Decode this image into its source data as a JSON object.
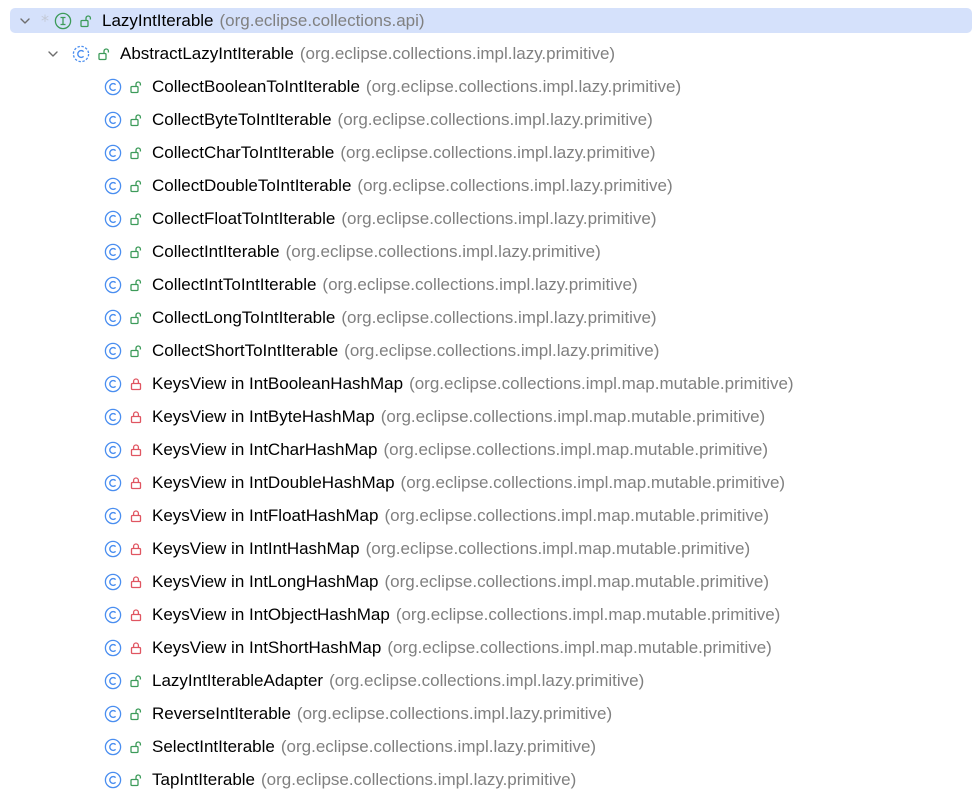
{
  "colors": {
    "selection": "#d5e1fb",
    "interface_icon": "#3d9b5a",
    "class_icon": "#4a8ef0",
    "public_lock": "#3d9b5a",
    "private_lock": "#e05561",
    "package_text": "#808080"
  },
  "tree": {
    "root": {
      "name": "LazyIntIterable",
      "package": "(org.eclipse.collections.api)",
      "kind_icon": "interface-icon",
      "visibility_icon": "public-lock-icon",
      "expanded": true,
      "selected": true
    },
    "parent": {
      "name": "AbstractLazyIntIterable",
      "package": "(org.eclipse.collections.impl.lazy.primitive)",
      "kind_icon": "abstract-class-icon",
      "visibility_icon": "public-lock-icon",
      "expanded": true
    },
    "children": [
      {
        "name": "CollectBooleanToIntIterable",
        "package": "(org.eclipse.collections.impl.lazy.primitive)",
        "visibility": "public"
      },
      {
        "name": "CollectByteToIntIterable",
        "package": "(org.eclipse.collections.impl.lazy.primitive)",
        "visibility": "public"
      },
      {
        "name": "CollectCharToIntIterable",
        "package": "(org.eclipse.collections.impl.lazy.primitive)",
        "visibility": "public"
      },
      {
        "name": "CollectDoubleToIntIterable",
        "package": "(org.eclipse.collections.impl.lazy.primitive)",
        "visibility": "public"
      },
      {
        "name": "CollectFloatToIntIterable",
        "package": "(org.eclipse.collections.impl.lazy.primitive)",
        "visibility": "public"
      },
      {
        "name": "CollectIntIterable",
        "package": "(org.eclipse.collections.impl.lazy.primitive)",
        "visibility": "public"
      },
      {
        "name": "CollectIntToIntIterable",
        "package": "(org.eclipse.collections.impl.lazy.primitive)",
        "visibility": "public"
      },
      {
        "name": "CollectLongToIntIterable",
        "package": "(org.eclipse.collections.impl.lazy.primitive)",
        "visibility": "public"
      },
      {
        "name": "CollectShortToIntIterable",
        "package": "(org.eclipse.collections.impl.lazy.primitive)",
        "visibility": "public"
      },
      {
        "name": "KeysView in IntBooleanHashMap",
        "package": "(org.eclipse.collections.impl.map.mutable.primitive)",
        "visibility": "private"
      },
      {
        "name": "KeysView in IntByteHashMap",
        "package": "(org.eclipse.collections.impl.map.mutable.primitive)",
        "visibility": "private"
      },
      {
        "name": "KeysView in IntCharHashMap",
        "package": "(org.eclipse.collections.impl.map.mutable.primitive)",
        "visibility": "private"
      },
      {
        "name": "KeysView in IntDoubleHashMap",
        "package": "(org.eclipse.collections.impl.map.mutable.primitive)",
        "visibility": "private"
      },
      {
        "name": "KeysView in IntFloatHashMap",
        "package": "(org.eclipse.collections.impl.map.mutable.primitive)",
        "visibility": "private"
      },
      {
        "name": "KeysView in IntIntHashMap",
        "package": "(org.eclipse.collections.impl.map.mutable.primitive)",
        "visibility": "private"
      },
      {
        "name": "KeysView in IntLongHashMap",
        "package": "(org.eclipse.collections.impl.map.mutable.primitive)",
        "visibility": "private"
      },
      {
        "name": "KeysView in IntObjectHashMap",
        "package": "(org.eclipse.collections.impl.map.mutable.primitive)",
        "visibility": "private"
      },
      {
        "name": "KeysView in IntShortHashMap",
        "package": "(org.eclipse.collections.impl.map.mutable.primitive)",
        "visibility": "private"
      },
      {
        "name": "LazyIntIterableAdapter",
        "package": "(org.eclipse.collections.impl.lazy.primitive)",
        "visibility": "public"
      },
      {
        "name": "ReverseIntIterable",
        "package": "(org.eclipse.collections.impl.lazy.primitive)",
        "visibility": "public"
      },
      {
        "name": "SelectIntIterable",
        "package": "(org.eclipse.collections.impl.lazy.primitive)",
        "visibility": "public"
      },
      {
        "name": "TapIntIterable",
        "package": "(org.eclipse.collections.impl.lazy.primitive)",
        "visibility": "public"
      }
    ]
  }
}
